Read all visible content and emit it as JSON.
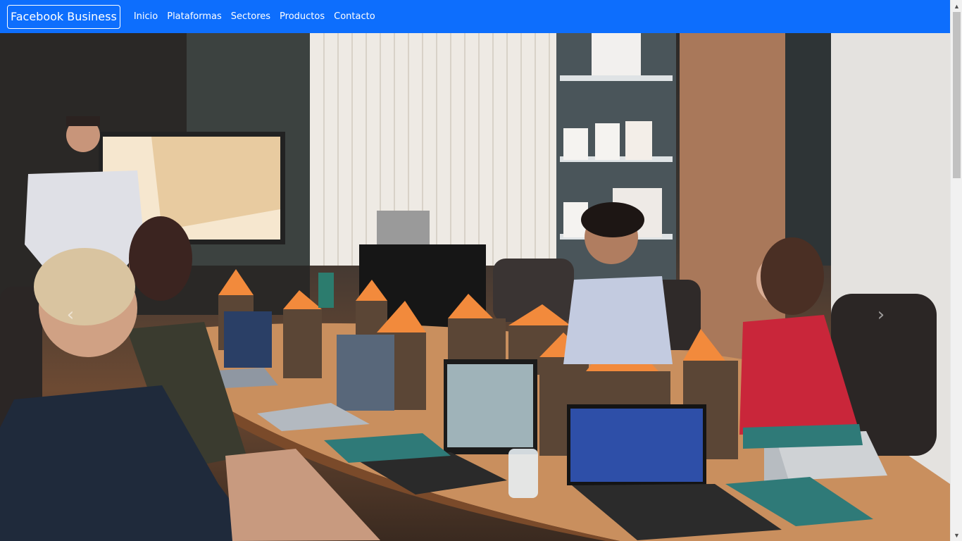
{
  "navbar": {
    "brand": "Facebook Business",
    "links": [
      "Inicio",
      "Plataformas",
      "Sectores",
      "Productos",
      "Contacto"
    ]
  },
  "hero": {
    "prev_icon": "chevron-left-icon",
    "next_icon": "chevron-right-icon",
    "prev_glyph": "‹",
    "next_glyph": "›"
  },
  "scrollbar": {
    "up_glyph": "▲",
    "down_glyph": "▼"
  },
  "colors": {
    "navbar": "#0d6efd",
    "text": "#ffffff"
  }
}
